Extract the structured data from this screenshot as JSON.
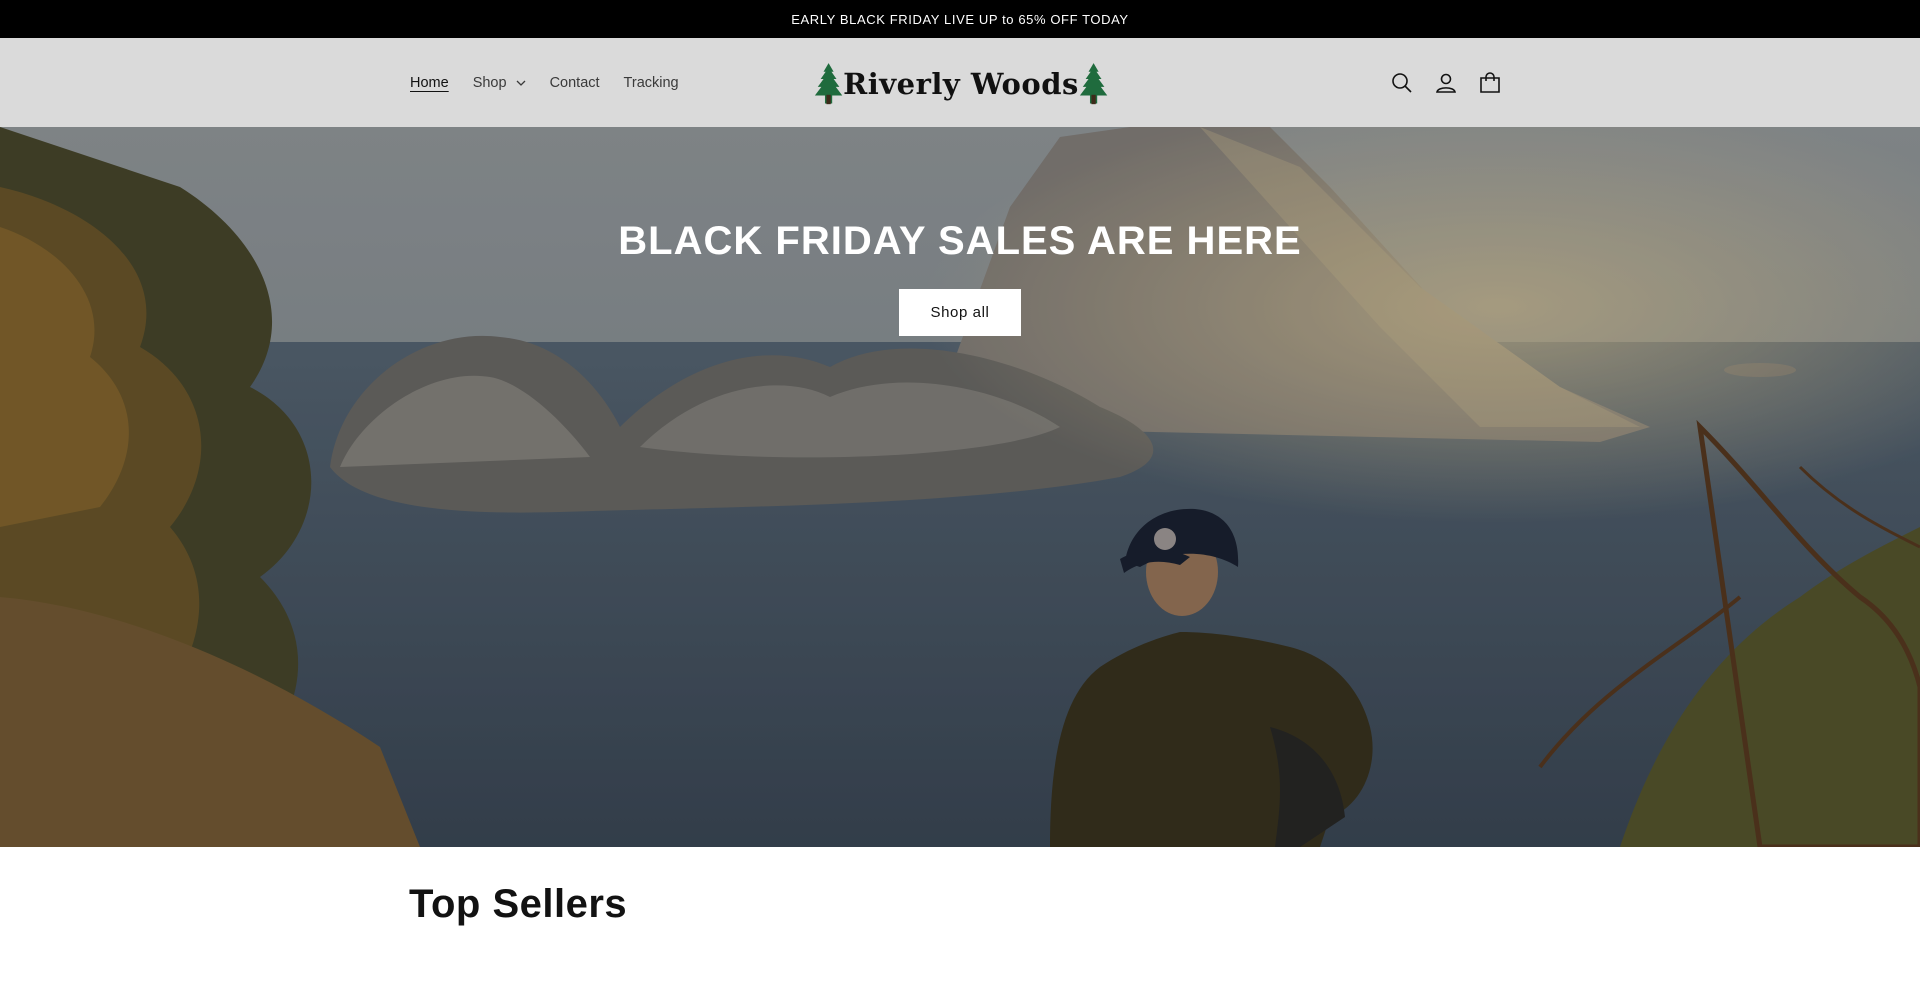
{
  "announcement": {
    "text": "EARLY BLACK FRIDAY LIVE UP to 65% OFF TODAY"
  },
  "header": {
    "nav": [
      {
        "label": "Home",
        "active": true
      },
      {
        "label": "Shop",
        "has_dropdown": true
      },
      {
        "label": "Contact"
      },
      {
        "label": "Tracking"
      }
    ],
    "logo": {
      "word1": "Riverly",
      "word2": "Woods",
      "tree_color": "#1f6b3d"
    },
    "icons": [
      "search-icon",
      "account-icon",
      "cart-icon"
    ]
  },
  "hero": {
    "title": "BLACK FRIDAY SALES ARE HERE",
    "button_label": "Shop all"
  },
  "section": {
    "title": "Top Sellers"
  },
  "colors": {
    "announcement_bg": "#000000",
    "header_bg": "#dadada",
    "accent_green": "#1f6b3d"
  }
}
